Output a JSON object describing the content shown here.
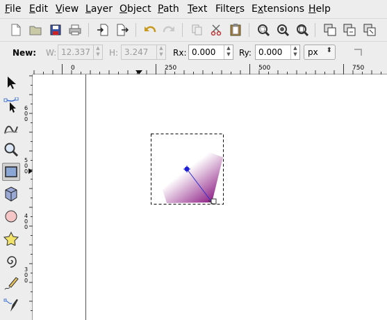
{
  "menu": {
    "file": {
      "ul": "F",
      "rest": "ile"
    },
    "edit": {
      "ul": "E",
      "rest": "dit"
    },
    "view": {
      "ul": "V",
      "rest": "iew"
    },
    "layer": {
      "ul": "L",
      "rest": "ayer"
    },
    "object": {
      "ul": "O",
      "rest": "bject"
    },
    "path": {
      "ul": "P",
      "rest": "ath"
    },
    "text": {
      "ul": "T",
      "rest": "ext"
    },
    "filters": {
      "pre": "Filte",
      "ul": "r",
      "rest": "s"
    },
    "extensions": {
      "pre": "E",
      "ul": "x",
      "rest": "tensions"
    },
    "help": {
      "ul": "H",
      "rest": "elp"
    }
  },
  "controls": {
    "mode_label": "New:",
    "w_label": "W:",
    "w_value": "12.337",
    "h_label": "H:",
    "h_value": "3.247",
    "rx_label": "Rx:",
    "rx_value": "0.000",
    "ry_label": "Ry:",
    "ry_value": "0.000",
    "unit": "px"
  },
  "ruler": {
    "h_labels": [
      "0",
      "250",
      "500",
      "750"
    ],
    "v_labels": [
      "6\n0\n0",
      "5\n0\n0",
      "4\n0\n0",
      "3\n0\n0"
    ]
  },
  "toolbox": {
    "active_tool": "rectangle-tool"
  },
  "colors": {
    "gradient_start": "#8b1a82",
    "gradient_end": "#ffffff",
    "handle": "#1f1fd6",
    "selection_dash": "#000000"
  }
}
